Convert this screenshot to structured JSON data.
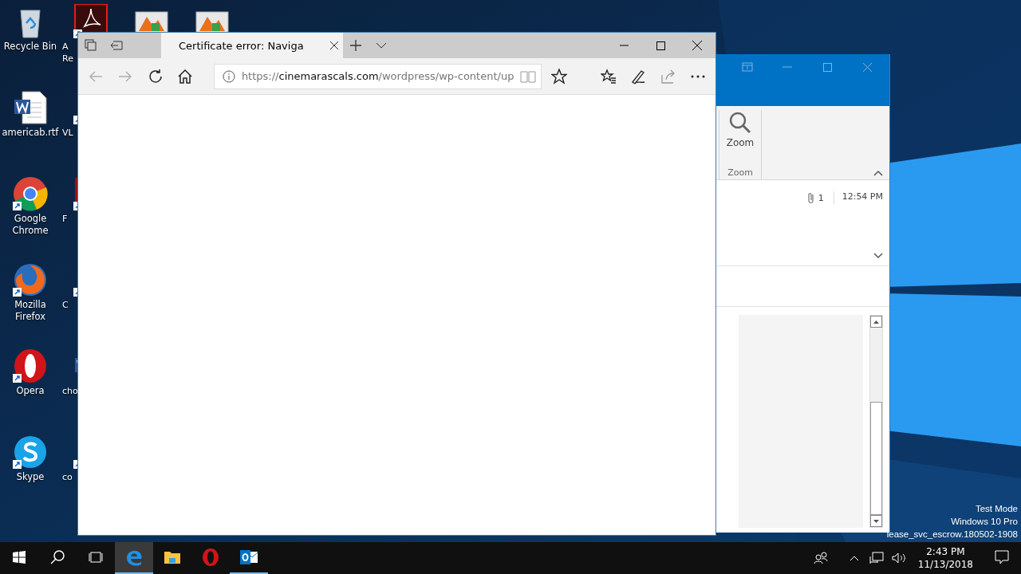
{
  "desktop_columns": [
    {
      "icons": [
        {
          "kind": "recycle",
          "lines": [
            "Recycle Bin"
          ]
        },
        {
          "kind": "word",
          "lines": [
            "americab.rtf"
          ]
        },
        {
          "kind": "chrome",
          "lines": [
            "Google",
            "Chrome"
          ]
        },
        {
          "kind": "firefox",
          "lines": [
            "Mozilla",
            "Firefox"
          ]
        },
        {
          "kind": "opera",
          "lines": [
            "Opera"
          ]
        },
        {
          "kind": "skype",
          "lines": [
            "Skype"
          ]
        }
      ]
    },
    {
      "icons": [
        {
          "kind": "acrobat",
          "lines": [
            "A",
            "Re"
          ]
        },
        {
          "kind": "shortcut",
          "lines": [
            "VL"
          ]
        },
        {
          "kind": "red",
          "lines": [
            "F"
          ]
        },
        {
          "kind": "shortcut",
          "lines": [
            "C"
          ]
        },
        {
          "kind": "word",
          "lines": [
            "cho"
          ]
        },
        {
          "kind": "file",
          "lines": [
            "co"
          ]
        }
      ]
    },
    {
      "icons": [
        {
          "kind": "setup"
        }
      ]
    },
    {
      "icons": [
        {
          "kind": "setup"
        }
      ]
    }
  ],
  "browser": {
    "tabs": [
      {
        "title": "Certificate error: Naviga",
        "selected": true
      }
    ],
    "nav": [
      {
        "kind": "back",
        "disabled": true
      },
      {
        "kind": "forward",
        "disabled": true
      },
      {
        "kind": "refresh",
        "disabled": false
      },
      {
        "kind": "home",
        "disabled": false
      }
    ],
    "address": {
      "scheme": "https://",
      "domain": "cinemarascals.com",
      "path": "/wordpress/wp-content/up"
    }
  },
  "outlook": {
    "ribbon_button": "Zoom",
    "ribbon_group": "Zoom",
    "attachments": "1",
    "time": "12:54 PM"
  },
  "watermark": [
    "Test Mode",
    "Windows 10 Pro",
    "lease_svc_escrow.180502-1908"
  ],
  "taskbar": {
    "apps": [
      {
        "kind": "edge",
        "selected": true,
        "running": true
      },
      {
        "kind": "explorer",
        "selected": false,
        "running": false
      },
      {
        "kind": "opera",
        "selected": false,
        "running": false
      },
      {
        "kind": "outlook",
        "selected": false,
        "running": true
      }
    ],
    "time": "2:43 PM",
    "date": "11/13/2018"
  }
}
